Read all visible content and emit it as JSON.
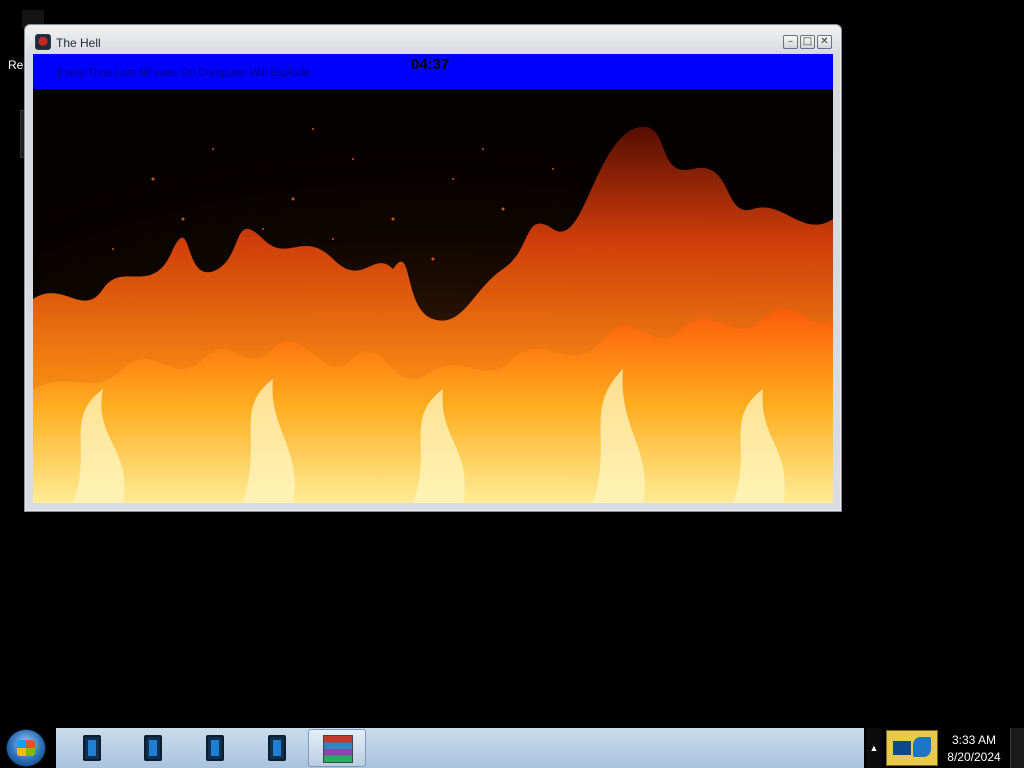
{
  "desktop": {
    "label": "Re"
  },
  "window": {
    "title": "The Hell",
    "minimize": "–",
    "maximize": "□",
    "close": "✕",
    "icon": "app-skull-icon",
    "warning_text": "Every Time Lost Minutes On Computer Will Explode",
    "timer": "04:37",
    "banner_color": "#0000ff"
  },
  "taskbar": {
    "start_icon": "windows-start-icon",
    "items": [
      {
        "icon": "app-tile-icon"
      },
      {
        "icon": "app-tile-icon"
      },
      {
        "icon": "app-tile-icon"
      },
      {
        "icon": "app-tile-icon"
      },
      {
        "icon": "winrar-icon"
      }
    ],
    "tray_arrow": "▲",
    "clock_time": "3:33 AM",
    "clock_date": "8/20/2024"
  }
}
